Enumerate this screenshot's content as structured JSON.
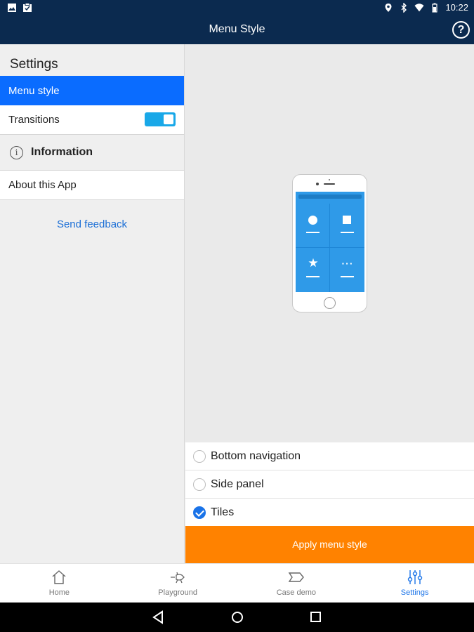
{
  "status_bar": {
    "time": "10:22",
    "left_icons": [
      "image-icon",
      "clipboard-check-icon"
    ],
    "right_icons": [
      "location-icon",
      "bluetooth-icon",
      "wifi-icon",
      "battery-icon"
    ]
  },
  "app_bar": {
    "title": "Menu Style",
    "help_label": "?"
  },
  "left_panel": {
    "header": "Settings",
    "items": [
      {
        "label": "Menu style",
        "active": true
      },
      {
        "label": "Transitions",
        "toggle": true
      }
    ],
    "information_header": "Information",
    "about_label": "About this App",
    "feedback_label": "Send feedback"
  },
  "right_panel": {
    "options": [
      {
        "label": "Bottom navigation",
        "checked": false
      },
      {
        "label": "Side panel",
        "checked": false
      },
      {
        "label": "Tiles",
        "checked": true
      }
    ],
    "apply_label": "Apply menu style"
  },
  "bottom_nav": {
    "items": [
      {
        "label": "Home",
        "icon": "home-icon"
      },
      {
        "label": "Playground",
        "icon": "playground-icon"
      },
      {
        "label": "Case demo",
        "icon": "tag-icon"
      },
      {
        "label": "Settings",
        "icon": "sliders-icon",
        "active": true
      }
    ]
  },
  "colors": {
    "app_bar": "#0b2a4f",
    "active_item": "#0a6cff",
    "toggle": "#19a8e8",
    "apply_button": "#ff8200",
    "active_nav": "#1a73e8"
  }
}
